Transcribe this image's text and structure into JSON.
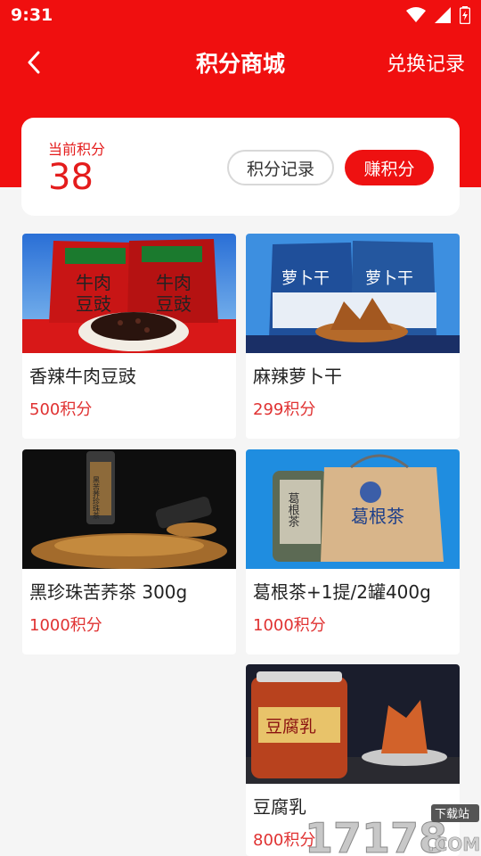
{
  "status_bar": {
    "time": "9:31"
  },
  "nav": {
    "title": "积分商城",
    "action": "兑换记录"
  },
  "points": {
    "label": "当前积分",
    "value": "38",
    "record_button": "积分记录",
    "earn_button": "赚积分"
  },
  "products": [
    {
      "name": "香辣牛肉豆豉",
      "price": "500积分",
      "image_text": [
        "牛肉",
        "豆豉"
      ]
    },
    {
      "name": "麻辣萝卜干",
      "price": "299积分",
      "image_text": [
        "萝卜干"
      ]
    },
    {
      "name": "黑珍珠苦荞茶 300g",
      "price": "1000积分",
      "image_text": [
        "黑苦荞珍珠茶"
      ]
    },
    {
      "name": "葛根茶+1提/2罐400g",
      "price": "1000积分",
      "image_text": [
        "葛根茶"
      ]
    },
    {
      "name": "豆腐乳",
      "price": "800积分",
      "image_text": [
        "豆腐乳"
      ]
    }
  ],
  "colors": {
    "brand_red": "#f00f0f",
    "price_red": "#e03232"
  },
  "watermark": {
    "number": "17178",
    "domain": ".COM",
    "tag": "下载站"
  }
}
